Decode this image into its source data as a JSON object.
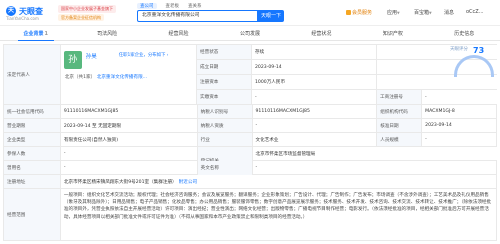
{
  "header": {
    "logo_text": "天眼查",
    "logo_mark": "天",
    "logo_sub": "TianYanCha.com",
    "badge_gov": "国家中小企业发展子基金旗下",
    "badge_gov2": "官方备案企业征信机构",
    "search_tabs": [
      "查公司",
      "查老板",
      "查关系"
    ],
    "search_value": "北京重洋文化传播有限公司",
    "search_button": "天眼一下",
    "nav_vip": "会员服务",
    "nav_app": "应用",
    "nav_business": "百宝箱",
    "nav_notice": "消息",
    "nav_user": "oCcZ..."
  },
  "tabs": [
    {
      "label": "企业背景",
      "count": "1"
    },
    {
      "label": "司法风险",
      "count": ""
    },
    {
      "label": "经营风险",
      "count": ""
    },
    {
      "label": "公司发展",
      "count": ""
    },
    {
      "label": "经营状况",
      "count": ""
    },
    {
      "label": "知识产权",
      "count": ""
    },
    {
      "label": "历史信息",
      "count": ""
    }
  ],
  "info": {
    "legal_label": "法定代表人",
    "avatar_char": "孙",
    "person_name": "孙昊",
    "person_tag": "任职1家企业，分布如下",
    "person_city": "北京（共1家）",
    "person_co": "北京重洋文化传播有限...",
    "status_label": "经营状态",
    "status_value": "存续",
    "found_label": "成立日期",
    "found_value": "2023-09-14",
    "reg_cap_label": "注册资本",
    "reg_cap_value": "1000万人民币",
    "paid_cap_label": "实缴资本",
    "paid_cap_value": "-",
    "score_label": "天眼评分",
    "score_value": "73",
    "reg_no_label": "工商注册号",
    "reg_no_value": "-",
    "credit_label": "统一社会信用代码",
    "credit_value": "91110116MACXM1GJ85",
    "tax_label": "纳税人识别号",
    "tax_value": "91110116MACXM1GJ85",
    "org_label": "组织机构代码",
    "org_value": "MACXM1GJ-8",
    "term_label": "营业期限",
    "term_value": "2023-09-14 至 无固定期限",
    "taxpayer_label": "纳税人资质",
    "taxpayer_value": "-",
    "approve_label": "核准日期",
    "approve_value": "2023-09-14",
    "type_label": "企业类型",
    "type_value": "有限责任公司(自然人独资)",
    "industry_label": "行业",
    "industry_value": "文化艺术业",
    "staff_label": "人员规模",
    "staff_value": "-",
    "insured_label": "参保人数",
    "insured_value": "-",
    "authority_label": "登记机关",
    "authority_value": "北京市怀柔区市场监督管理局",
    "former_label": "曾用名",
    "former_value": "-",
    "en_label": "英文名称",
    "en_value": "-",
    "addr_label": "注册地址",
    "addr_value": "北京市怀柔区杨宋镇凤翔东大街9号201室（集群注册）",
    "addr_link": "附近公司",
    "scope_label": "经营范围",
    "scope_value": "一般项目：组织文化艺术交流活动；版权代理；社会经济咨询服务；会议及展览服务；翻译服务；企业形象策划；广告设计、代理；广告制作；广告发布；市场调查（不含涉外调查）；工艺美术品及礼仪用品销售（象牙及其制品除外）；日用品销售；电子产品销售；化妆品零售；办公用品销售；服装服饰零售；数字创意产品展览展示服务；技术服务、技术开发、技术咨询、技术交流、技术转让、技术推广；（除依法须经批准的项目外，凭营业执照依法自主开展经营活动）许可项目：演出经纪；营业性演出；网络文化经营；出版物零售；广播电视节目制作经营；电影发行。（依法须经批准的项目，经相关部门批准后方可开展经营活动，具体经营项目以相关部门批准文件或许可证件为准）（不得从事国家和本市产业政策禁止和限制类项目的经营活动。）"
  },
  "colors": {
    "accent": "#1677ff",
    "label_bg": "#f5f8fc",
    "avatar": "#58b87e"
  }
}
